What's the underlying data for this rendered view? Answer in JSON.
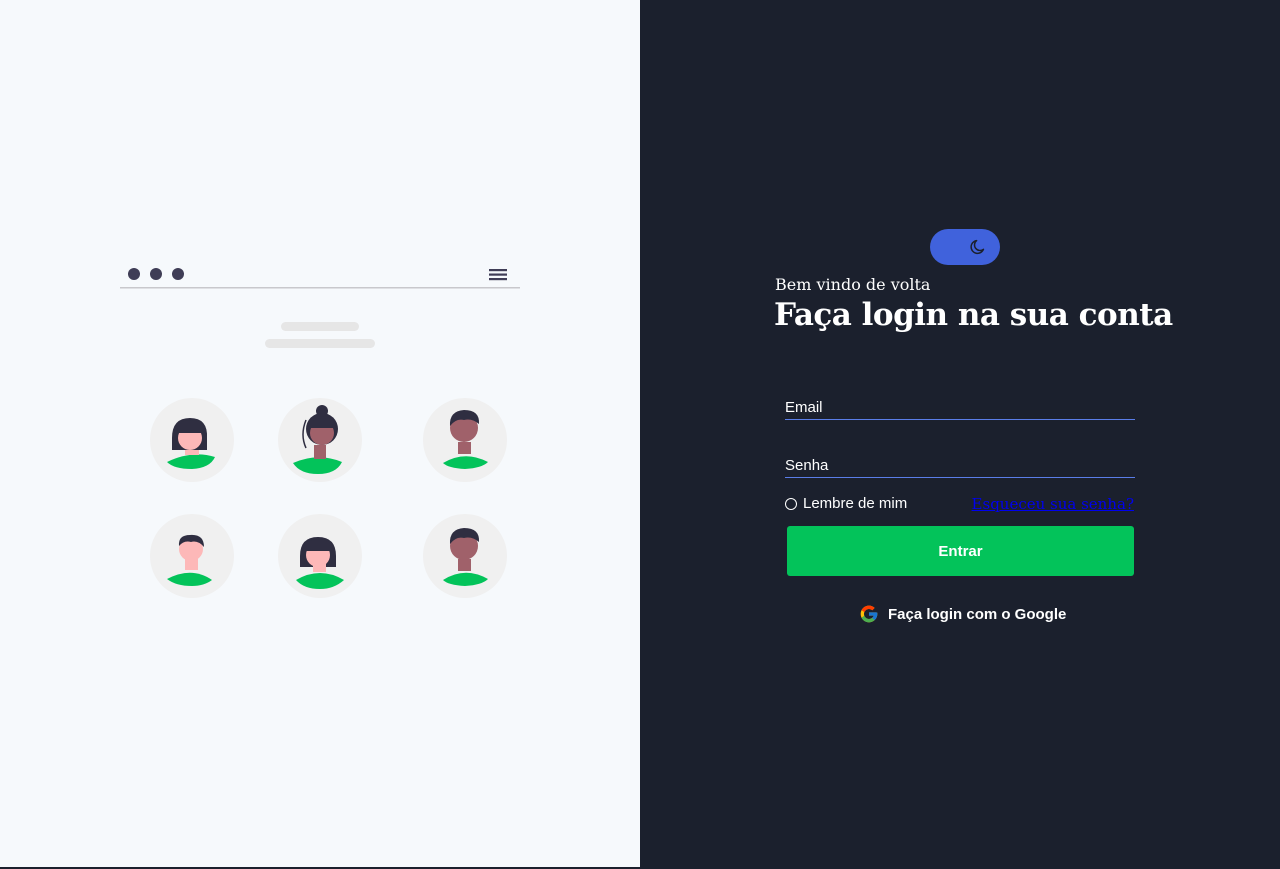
{
  "login": {
    "welcome": "Bem vindo de volta",
    "heading": "Faça login na sua conta",
    "email_placeholder": "Email",
    "password_placeholder": "Senha",
    "remember_label": "Lembre de mim",
    "forgot_link": "Esqueceu sua senha?",
    "submit_label": "Entrar",
    "google_label": "Faça login com o Google"
  },
  "theme_toggle": {
    "icon": "moon-icon"
  },
  "colors": {
    "accent_green": "#03c35a",
    "toggle_blue": "#4062dc",
    "dark_background": "#1b202d",
    "light_background": "#f6f9fc"
  }
}
